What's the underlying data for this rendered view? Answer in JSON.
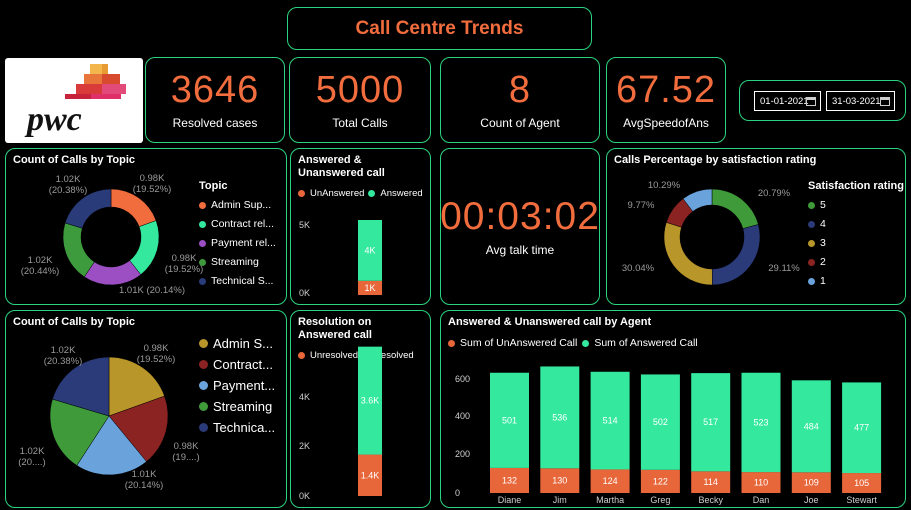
{
  "title": "Call Centre Trends",
  "logo_text": "pwc",
  "kpis": [
    {
      "value": "3646",
      "label": "Resolved cases"
    },
    {
      "value": "5000",
      "label": "Total Calls"
    },
    {
      "value": "8",
      "label": "Count of Agent"
    },
    {
      "value": "67.52",
      "label": "AvgSpeedofAns"
    }
  ],
  "dates": {
    "start": "01-01-2021",
    "end": "31-03-2021"
  },
  "talk_time": {
    "value": "00:03:02",
    "label": "Avg talk time"
  },
  "colors": {
    "accent": "#f26d3d",
    "border": "#2bd37f",
    "admin": "#f26d3d",
    "contract": "#34e89e",
    "payment": "#9b4fc3",
    "streaming": "#3d9a3d",
    "technical": "#2a3b7a",
    "answered": "#34e89e",
    "unanswered": "#e8673a",
    "pie_admin": "#b8962a",
    "pie_contract": "#8b2323",
    "pie_payment": "#6aa3dc",
    "pie_streaming": "#3f9a3a",
    "pie_technical": "#2b3a78",
    "rate5": "#3f9a3a",
    "rate4": "#2b3a78",
    "rate3": "#b8962a",
    "rate2": "#8b2323",
    "rate1": "#6aa3dc"
  },
  "chart_data": [
    {
      "type": "pie",
      "variant": "donut",
      "title": "Count of Calls by Topic",
      "legend_title": "Topic",
      "labels": [
        "Admin Sup...",
        "Contract rel...",
        "Payment rel...",
        "Streaming",
        "Technical S..."
      ],
      "values": [
        976,
        1000,
        1007,
        1022,
        1019
      ],
      "slice_labels": [
        "0.98K\n(19.52%)",
        "",
        "0.98K\n(19.52%)",
        "1.01K (20.14%)",
        "1.02K\n(20.44%)",
        "1.02K\n(20.38%)"
      ],
      "legend_position": "right"
    },
    {
      "type": "bar",
      "stacked": true,
      "title": "Answered & Unanswered call",
      "categories": [
        ""
      ],
      "series": [
        {
          "name": "UnAnswered",
          "values": [
            946
          ],
          "label": "1K"
        },
        {
          "name": "Answered",
          "values": [
            4054
          ],
          "label": "4K"
        }
      ],
      "yticks": [
        "5K",
        "0K"
      ],
      "ylim": [
        0,
        5000
      ]
    },
    {
      "type": "pie",
      "variant": "donut",
      "title": "Calls Percentage by satisfaction rating",
      "legend_title": "Satisfaction rating",
      "labels": [
        "5",
        "4",
        "3",
        "2",
        "1"
      ],
      "values": [
        20.79,
        29.11,
        30.04,
        9.77,
        10.29
      ],
      "slice_labels": [
        "20.79%",
        "29.11%",
        "30.04%",
        "9.77%",
        "10.29%"
      ],
      "legend_position": "right"
    },
    {
      "type": "pie",
      "title": "Count of Calls by Topic",
      "labels": [
        "Admin S...",
        "Contract...",
        "Payment...",
        "Streaming",
        "Technica..."
      ],
      "values": [
        976,
        976,
        1007,
        1022,
        1019
      ],
      "slice_labels": [
        "0.98K\n(19.52%)",
        "0.98K\n(19....)",
        "1.01K\n(20.14%)",
        "1.02K\n(20....)",
        "1.02K\n(20.38%)"
      ],
      "legend_position": "right"
    },
    {
      "type": "bar",
      "stacked": true,
      "title": "Resolution on Answered call",
      "categories": [
        ""
      ],
      "series": [
        {
          "name": "Unresolved",
          "values": [
            1400
          ],
          "label": "1.4K"
        },
        {
          "name": "Resolved",
          "values": [
            3646
          ],
          "label": "3.6K"
        }
      ],
      "yticks": [
        "4K",
        "2K",
        "0K"
      ],
      "ylim": [
        0,
        5000
      ]
    },
    {
      "type": "bar",
      "stacked": true,
      "title": "Answered & Unanswered call by Agent",
      "categories": [
        "Diane",
        "Jim",
        "Martha",
        "Greg",
        "Becky",
        "Dan",
        "Joe",
        "Stewart"
      ],
      "series": [
        {
          "name": "Sum of UnAnswered Call",
          "values": [
            132,
            130,
            124,
            122,
            114,
            110,
            109,
            105
          ]
        },
        {
          "name": "Sum of Answered Call",
          "values": [
            501,
            536,
            514,
            502,
            517,
            523,
            484,
            477
          ]
        }
      ],
      "yticks": [
        600,
        400,
        200,
        0
      ],
      "ylim": [
        0,
        700
      ]
    }
  ]
}
